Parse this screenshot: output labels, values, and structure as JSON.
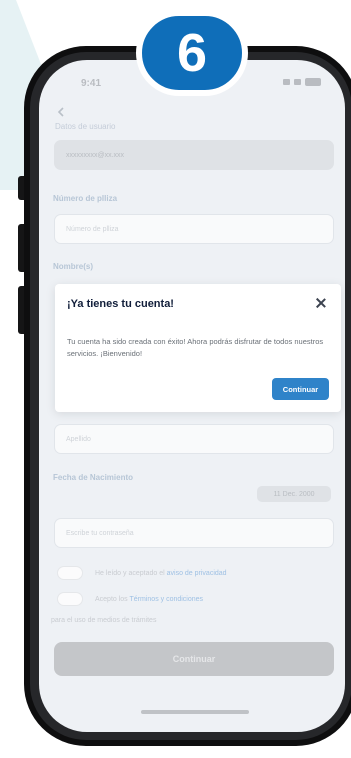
{
  "step_badge": "6",
  "status_bar": {
    "time": "9:41"
  },
  "form": {
    "faint_label": "Datos de usuario",
    "prefilled_value": "xxxxxxxxx@xx.xxx",
    "label_phone": "Número de plliza",
    "phone_placeholder": "Número de plliza",
    "label_names": "Nombre(s)",
    "label_surname": "Apellido",
    "surname_placeholder": "Apellido",
    "label_birthdate": "Fecha de Nacimiento",
    "date_value": "11 Dec. 2000",
    "password_placeholder": "Escribe tu contraseña",
    "terms_prefix": "He leído y aceptado el",
    "terms_link": "aviso de privacidad",
    "consent_prefix": "Acepto los",
    "consent_link": "Términos y condiciones",
    "note": "para el uso de medios de trámites",
    "continue_label": "Continuar"
  },
  "modal": {
    "title": "¡Ya tienes tu cuenta!",
    "body": "Tu cuenta ha sido creada con éxito! Ahora podrás disfrutar de todos nuestros servicios. ¡Bienvenido!",
    "button_label": "Continuar"
  },
  "colors": {
    "badge_blue": "#0f6eb9",
    "modal_button": "#2f83c9",
    "title_navy": "#111e3a"
  }
}
